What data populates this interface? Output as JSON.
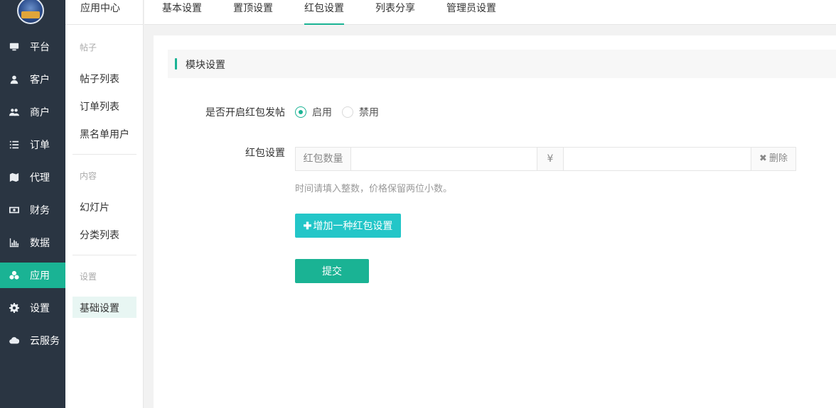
{
  "sidebar": {
    "items": [
      {
        "label": "平台",
        "icon": "monitor-icon"
      },
      {
        "label": "客户",
        "icon": "user-icon"
      },
      {
        "label": "商户",
        "icon": "users-icon"
      },
      {
        "label": "订单",
        "icon": "list-icon"
      },
      {
        "label": "代理",
        "icon": "map-icon"
      },
      {
        "label": "财务",
        "icon": "money-icon"
      },
      {
        "label": "数据",
        "icon": "bar-chart-icon"
      },
      {
        "label": "应用",
        "icon": "cubes-icon"
      },
      {
        "label": "设置",
        "icon": "gear-icon"
      },
      {
        "label": "云服务",
        "icon": "cloud-icon"
      }
    ],
    "active_index": 7
  },
  "submenu": {
    "header": "应用中心",
    "groups": [
      {
        "title": "帖子",
        "links": [
          "帖子列表",
          "订单列表",
          "黑名单用户"
        ]
      },
      {
        "title": "内容",
        "links": [
          "幻灯片",
          "分类列表"
        ]
      },
      {
        "title": "设置",
        "links": [
          "基础设置"
        ]
      }
    ]
  },
  "tabs": [
    "基本设置",
    "置顶设置",
    "红包设置",
    "列表分享",
    "管理员设置"
  ],
  "active_tab": "红包设置",
  "section": {
    "title": "模块设置"
  },
  "form": {
    "enable_label": "是否开启红包发帖",
    "enable_option": "启用",
    "disable_option": "禁用",
    "enabled": true,
    "packet_label": "红包设置",
    "count_addon": "红包数量",
    "count_value": "",
    "currency_addon": "¥",
    "price_value": "",
    "delete_label": "删除",
    "hint": "时间请填入整数，价格保留两位小数。",
    "add_button": "增加一种红包设置",
    "submit_button": "提交"
  },
  "colors": {
    "accent": "#1ab394",
    "accent_alt": "#23c6c8",
    "sidebar_bg": "#2a3542"
  }
}
